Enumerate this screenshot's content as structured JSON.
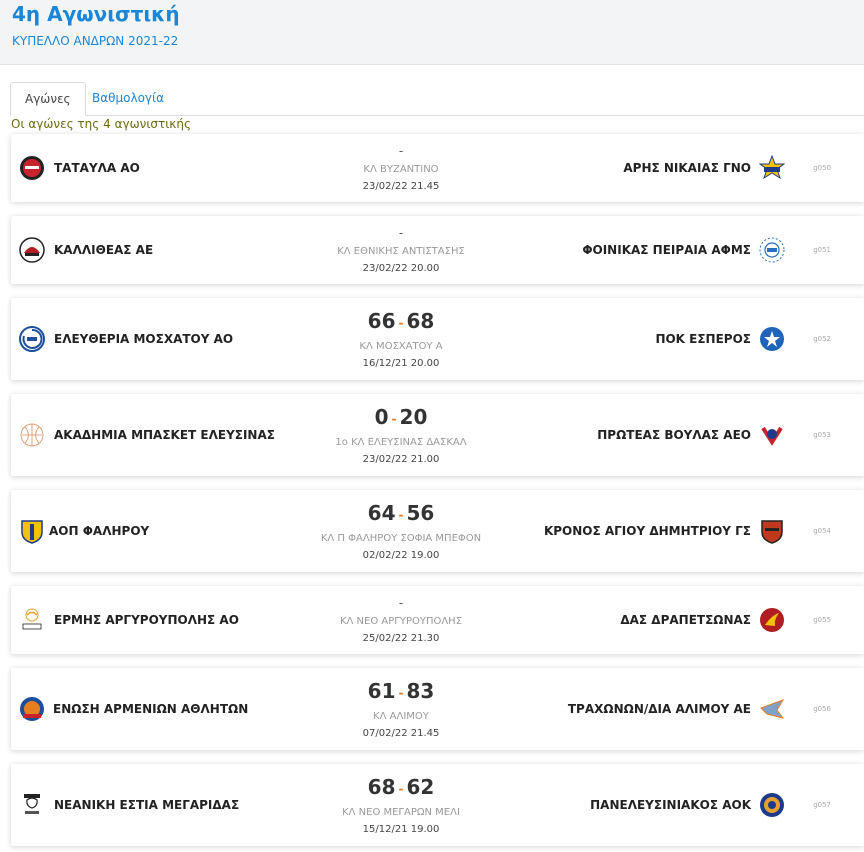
{
  "header": {
    "title": "4η Αγωνιστική",
    "subtitle": "ΚΥΠΕΛΛΟ ΑΝΔΡΩΝ 2021-22"
  },
  "tabs": [
    {
      "label": "Αγώνες",
      "active": true
    },
    {
      "label": "Βαθμολογία",
      "active": false
    }
  ],
  "round_caption": "Οι αγώνες της 4 αγωνιστικής",
  "matches": [
    {
      "home": "ΤΑΤΑΥΛΑ ΑΟ",
      "away": "ΑΡΗΣ ΝΙΚΑΙΑΣ ΓΝΟ",
      "home_score": "",
      "away_score": "",
      "dash": "-",
      "venue": "ΚΛ ΒΥΖΑΝΤΙΝΟ",
      "datetime": "23/02/22 21.45",
      "code": "g050",
      "home_icon": "tatavla-logo-icon",
      "away_icon": "aris-nikaias-logo-icon"
    },
    {
      "home": "ΚΑΛΛΙΘΕΑΣ ΑΕ",
      "away": "ΦΟΙΝΙΚΑΣ ΠΕΙΡΑΙΑ ΑΦΜΣ",
      "home_score": "",
      "away_score": "",
      "dash": "-",
      "venue": "ΚΛ ΕΘΝΙΚΗΣ ΑΝΤΙΣΤΑΣΗΣ",
      "datetime": "23/02/22 20.00",
      "code": "g051",
      "home_icon": "kallitheas-logo-icon",
      "away_icon": "foinikas-logo-icon"
    },
    {
      "home": "ΕΛΕΥΘΕΡΙΑ ΜΟΣΧΑΤΟΥ ΑΟ",
      "away": "ΠΟΚ ΕΣΠΕΡΟΣ",
      "home_score": "66",
      "away_score": "68",
      "dash": "",
      "venue": "ΚΛ ΜΟΣΧΑΤΟΥ Α",
      "datetime": "16/12/21 20.00",
      "code": "g052",
      "home_icon": "eleftheria-logo-icon",
      "away_icon": "pok-esperos-logo-icon"
    },
    {
      "home": "ΑΚΑΔΗΜΙΑ ΜΠΑΣΚΕΤ ΕΛΕΥΣΙΝΑΣ",
      "away": "ΠΡΩΤΕΑΣ ΒΟΥΛΑΣ ΑΕΟ",
      "home_score": "0",
      "away_score": "20",
      "dash": "",
      "venue": "1ο ΚΛ ΕΛΕΥΣΙΝΑΣ ΔΑΣΚΑΛ",
      "datetime": "23/02/22 21.00",
      "code": "g053",
      "home_icon": "akadimia-logo-icon",
      "away_icon": "proteas-logo-icon"
    },
    {
      "home": "ΑΟΠ ΦΑΛΗΡΟΥ",
      "away": "ΚΡΟΝΟΣ ΑΓΙΟΥ ΔΗΜΗΤΡΙΟΥ ΓΣ",
      "home_score": "64",
      "away_score": "56",
      "dash": "",
      "venue": "ΚΛ Π ΦΑΛΗΡΟΥ ΣΟΦΙΑ ΜΠΕΦΟΝ",
      "datetime": "02/02/22 19.00",
      "code": "g054",
      "home_icon": "aop-falirou-logo-icon",
      "away_icon": "kronos-logo-icon"
    },
    {
      "home": "ΕΡΜΗΣ ΑΡΓΥΡΟΥΠΟΛΗΣ ΑΟ",
      "away": "ΔΑΣ ΔΡΑΠΕΤΣΩΝΑΣ",
      "home_score": "",
      "away_score": "",
      "dash": "-",
      "venue": "ΚΛ ΝΕΟ ΑΡΓΥΡΟΥΠΟΛΗΣ",
      "datetime": "25/02/22 21.30",
      "code": "g055",
      "home_icon": "ermis-logo-icon",
      "away_icon": "das-drapetsonas-logo-icon"
    },
    {
      "home": "ΕΝΩΣΗ ΑΡΜΕΝΙΩΝ ΑΘΛΗΤΩΝ",
      "away": "ΤΡΑΧΩΝΩΝ/ΔΙΑ ΑΛΙΜΟΥ ΑΕ",
      "home_score": "61",
      "away_score": "83",
      "dash": "",
      "venue": "ΚΛ ΑΛΙΜΟΥ",
      "datetime": "07/02/22 21.45",
      "code": "g056",
      "home_icon": "enosi-armenion-logo-icon",
      "away_icon": "trachonon-logo-icon"
    },
    {
      "home": "ΝΕΑΝΙΚΗ ΕΣΤΙΑ ΜΕΓΑΡΙΔΑΣ",
      "away": "ΠΑΝΕΛΕΥΣΙΝΙΑΚΟΣ ΑΟΚ",
      "home_score": "68",
      "away_score": "62",
      "dash": "",
      "venue": "ΚΛ ΝΕΟ ΜΕΓΑΡΩΝ ΜΕΛΙ",
      "datetime": "15/12/21 19.00",
      "code": "g057",
      "home_icon": "nea-megaridas-logo-icon",
      "away_icon": "panelefsiniakos-logo-icon"
    }
  ],
  "colors": {
    "accent": "#1a86d8",
    "score_separator": "#e07a2a"
  }
}
